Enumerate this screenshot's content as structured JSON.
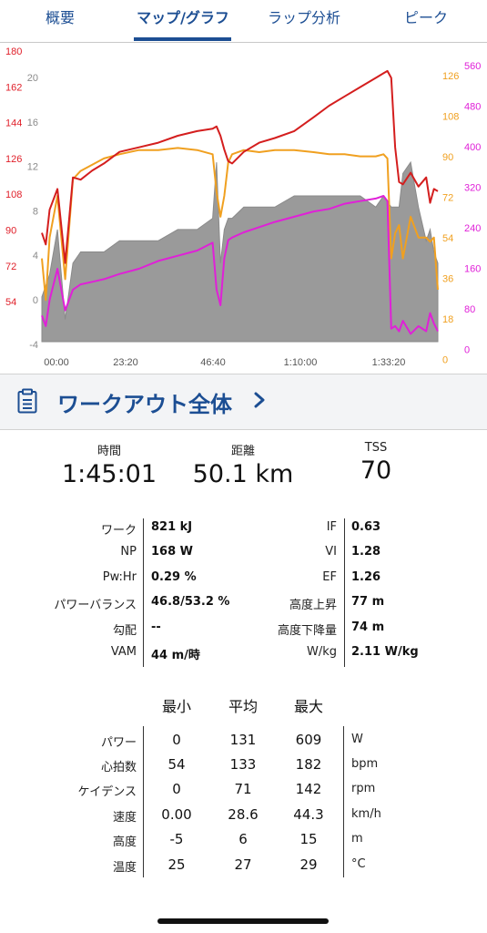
{
  "tabs": [
    {
      "label": "概要",
      "active": false
    },
    {
      "label": "マップ/グラフ",
      "active": true
    },
    {
      "label": "ラップ分析",
      "active": false
    },
    {
      "label": "ピーク",
      "active": false
    }
  ],
  "chart_data": {
    "type": "line",
    "x_unit": "time (h:mm)",
    "x_ticks": [
      "00:00",
      "23:20",
      "46:40",
      "1:10:00",
      "1:33:20"
    ],
    "axes": {
      "heart_rate": {
        "color": "#e0202a",
        "ticks": [
          "180",
          "162",
          "144",
          "126",
          "108",
          "90",
          "72",
          "54"
        ]
      },
      "elevation": {
        "color": "#8a8a8a",
        "ticks": [
          "20",
          "16",
          "12",
          "8",
          "4",
          "0",
          "-4"
        ]
      },
      "cadence": {
        "color": "#f0a020",
        "ticks": [
          "126",
          "108",
          "90",
          "72",
          "54",
          "36",
          "18",
          "0"
        ]
      },
      "power": {
        "color": "#e020d8",
        "ticks": [
          "560",
          "480",
          "400",
          "320",
          "240",
          "160",
          "80",
          "0"
        ]
      }
    },
    "series": [
      {
        "axis": "heart_rate",
        "t": [
          0,
          1,
          2,
          4,
          6,
          8,
          10,
          13,
          16,
          20,
          25,
          30,
          35,
          40,
          44,
          45,
          46,
          47,
          48,
          49,
          52,
          56,
          60,
          65,
          70,
          74,
          78,
          82,
          86,
          88,
          89,
          90,
          91,
          92,
          93,
          95,
          97,
          99,
          100,
          101,
          102
        ],
        "values": [
          101,
          96,
          111,
          120,
          88,
          125,
          124,
          128,
          131,
          136,
          138,
          140,
          143,
          145,
          146,
          147,
          143,
          137,
          132,
          131,
          136,
          140,
          142,
          145,
          151,
          156,
          160,
          164,
          168,
          170,
          171,
          168,
          138,
          123,
          122,
          127,
          121,
          125,
          114,
          120,
          119
        ]
      },
      {
        "axis": "cadence",
        "t": [
          0,
          1,
          2,
          4,
          6,
          8,
          10,
          13,
          16,
          20,
          25,
          30,
          35,
          40,
          44,
          45,
          46,
          47,
          48,
          49,
          52,
          56,
          60,
          65,
          70,
          74,
          78,
          82,
          86,
          88,
          89,
          90,
          91,
          92,
          93,
          95,
          97,
          99,
          100,
          101,
          102
        ],
        "values": [
          40,
          20,
          50,
          70,
          30,
          78,
          82,
          85,
          88,
          90,
          92,
          92,
          93,
          92,
          90,
          72,
          60,
          70,
          86,
          90,
          92,
          91,
          92,
          92,
          91,
          90,
          90,
          89,
          89,
          90,
          88,
          40,
          52,
          56,
          40,
          60,
          50,
          50,
          48,
          50,
          25
        ]
      },
      {
        "axis": "power",
        "t": [
          0,
          1,
          2,
          4,
          6,
          8,
          10,
          13,
          16,
          20,
          25,
          30,
          35,
          40,
          44,
          45,
          46,
          47,
          48,
          49,
          52,
          56,
          60,
          65,
          70,
          74,
          78,
          82,
          86,
          88,
          89,
          90,
          91,
          92,
          93,
          95,
          97,
          99,
          100,
          101,
          102
        ],
        "values": [
          50,
          30,
          80,
          140,
          60,
          100,
          110,
          115,
          120,
          130,
          140,
          155,
          165,
          175,
          190,
          100,
          70,
          160,
          195,
          200,
          210,
          220,
          230,
          240,
          250,
          255,
          265,
          270,
          275,
          280,
          270,
          25,
          30,
          20,
          40,
          15,
          30,
          20,
          55,
          35,
          20
        ]
      },
      {
        "axis": "elevation",
        "t": [
          0,
          2,
          4,
          6,
          8,
          10,
          13,
          16,
          20,
          25,
          30,
          35,
          40,
          44,
          45,
          46,
          47,
          48,
          49,
          52,
          56,
          60,
          65,
          70,
          74,
          78,
          82,
          86,
          88,
          90,
          92,
          93,
          95,
          97,
          99,
          100,
          101,
          102
        ],
        "values": [
          0,
          2,
          6,
          -2,
          3,
          4,
          4,
          4,
          5,
          5,
          5,
          6,
          6,
          7,
          12,
          3,
          6,
          7,
          7,
          8,
          8,
          8,
          9,
          9,
          9,
          9,
          9,
          8,
          9,
          8,
          8,
          11,
          12,
          8,
          5,
          6,
          4,
          3
        ]
      }
    ],
    "x_max": 102
  },
  "banner": {
    "title": "ワークアウト全体"
  },
  "highlights": [
    {
      "label": "時間",
      "value": "1:45:01"
    },
    {
      "label": "距離",
      "value": "50.1 km"
    },
    {
      "label": "TSS",
      "value": "70"
    }
  ],
  "metrics_left": [
    {
      "label": "ワーク",
      "value": "821 kJ"
    },
    {
      "label": "NP",
      "value": "168 W"
    },
    {
      "label": "Pw:Hr",
      "value": "0.29 %"
    },
    {
      "label": "パワーバランス",
      "value": "46.8/53.2 %"
    },
    {
      "label": "勾配",
      "value": "--"
    },
    {
      "label": "VAM",
      "value": "44 m/時"
    }
  ],
  "metrics_right": [
    {
      "label": "IF",
      "value": "0.63"
    },
    {
      "label": "VI",
      "value": "1.28"
    },
    {
      "label": "EF",
      "value": "1.26"
    },
    {
      "label": "高度上昇",
      "value": "77 m"
    },
    {
      "label": "高度下降量",
      "value": "74 m"
    },
    {
      "label": "W/kg",
      "value": "2.11 W/kg"
    }
  ],
  "minmax": {
    "headers": [
      "最小",
      "平均",
      "最大"
    ],
    "rows": [
      {
        "label": "パワー",
        "min": "0",
        "avg": "131",
        "max": "609",
        "unit": "W"
      },
      {
        "label": "心拍数",
        "min": "54",
        "avg": "133",
        "max": "182",
        "unit": "bpm"
      },
      {
        "label": "ケイデンス",
        "min": "0",
        "avg": "71",
        "max": "142",
        "unit": "rpm"
      },
      {
        "label": "速度",
        "min": "0.00",
        "avg": "28.6",
        "max": "44.3",
        "unit": "km/h"
      },
      {
        "label": "高度",
        "min": "-5",
        "avg": "6",
        "max": "15",
        "unit": "m"
      },
      {
        "label": "温度",
        "min": "25",
        "avg": "27",
        "max": "29",
        "unit": "°C"
      }
    ]
  }
}
